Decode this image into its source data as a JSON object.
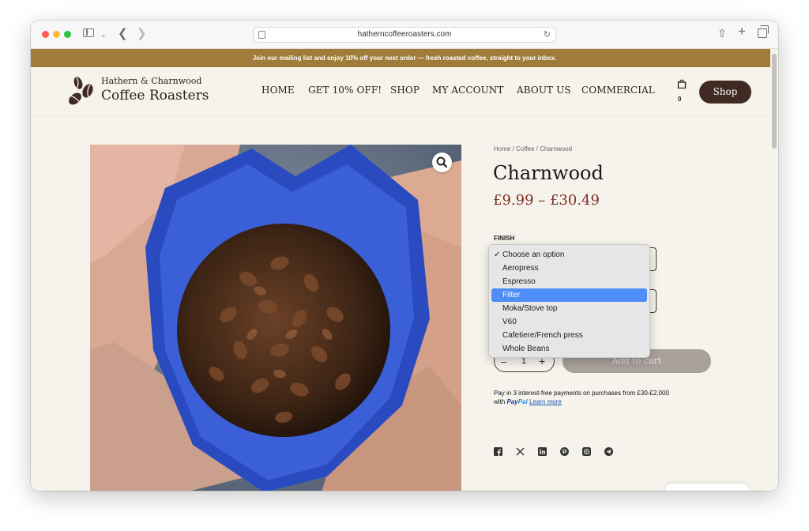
{
  "browser": {
    "url": "hatherncoffeeroasters.com"
  },
  "announcement": "Join our mailing list and enjoy 10% off your next order — fresh roasted coffee, straight to your inbox.",
  "logo": {
    "line1": "Hathern & Charnwood",
    "line2": "Coffee Roasters"
  },
  "nav": {
    "items": [
      "HOME",
      "GET 10% OFF!",
      "SHOP",
      "MY ACCOUNT",
      "ABOUT US",
      "COMMERCIAL"
    ],
    "cart_count": "0",
    "shop_button": "Shop"
  },
  "breadcrumb": {
    "home": "Home",
    "sep": " / ",
    "category": "Coffee",
    "current": "Charnwood"
  },
  "product": {
    "title": "Charnwood",
    "price": "£9.99 – £30.49",
    "finish_label": "FINISH",
    "quantity": "1",
    "qty_minus": "–",
    "qty_plus": "+",
    "add_to_cart": "Add to cart"
  },
  "finish_dropdown": {
    "options": [
      "Choose an option",
      "Aeropress",
      "Espresso",
      "Filter",
      "Moka/Stove top",
      "V60",
      "Cafetiere/French press",
      "Whole Beans"
    ],
    "checked": "Choose an option",
    "highlighted": "Filter"
  },
  "paypal": {
    "line1": "Pay in 3 interest-free payments on purchases from £30-£2,000",
    "with": "with ",
    "logo_pay": "Pay",
    "logo_pal": "Pal",
    "learn_more": "Learn more"
  },
  "share_icons": [
    "facebook-icon",
    "x-icon",
    "linkedin-icon",
    "pinterest-icon",
    "whatsapp-icon",
    "telegram-icon"
  ],
  "colors": {
    "announcement_bg": "#a07c3a",
    "shop_button_bg": "#3f2a24",
    "price": "#7e2f22",
    "page_bg": "#f6f3ec",
    "dropdown_highlight": "#4f8ef7"
  }
}
